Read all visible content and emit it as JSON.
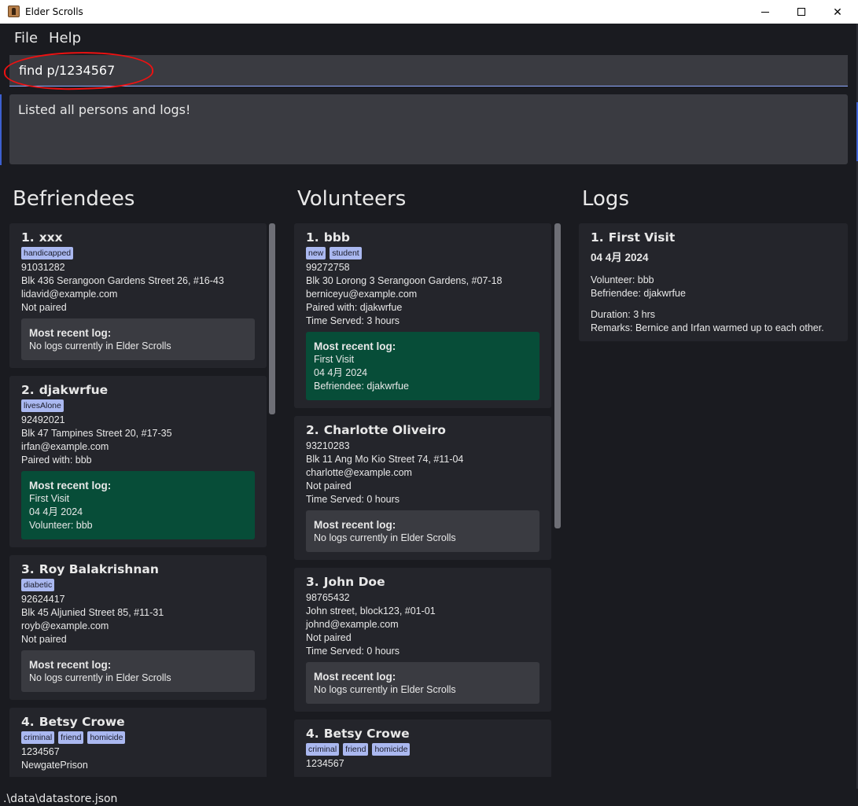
{
  "window": {
    "title": "Elder Scrolls"
  },
  "menu": {
    "file": "File",
    "help": "Help"
  },
  "command": {
    "value": "find p/1234567"
  },
  "result": {
    "text": "Listed all persons and logs!"
  },
  "headers": {
    "befriendees": "Befriendees",
    "volunteers": "Volunteers",
    "logs": "Logs"
  },
  "recent_label": "Most recent log:",
  "befriendees": [
    {
      "index": "1.",
      "name": "xxx",
      "tags": [
        "handicapped"
      ],
      "phone": "91031282",
      "address": "Blk 436 Serangoon Gardens Street 26, #16-43",
      "email": "lidavid@example.com",
      "pairing": "Not paired",
      "recent": {
        "empty": true,
        "lines": [
          "No logs currently in Elder Scrolls"
        ]
      }
    },
    {
      "index": "2.",
      "name": "djakwrfue",
      "tags": [
        "livesAlone"
      ],
      "phone": "92492021",
      "address": "Blk 47 Tampines Street 20, #17-35",
      "email": "irfan@example.com",
      "pairing": "Paired with: bbb",
      "recent": {
        "empty": false,
        "lines": [
          "First Visit",
          "04 4月 2024",
          "Volunteer: bbb"
        ]
      }
    },
    {
      "index": "3.",
      "name": "Roy Balakrishnan",
      "tags": [
        "diabetic"
      ],
      "phone": "92624417",
      "address": "Blk 45 Aljunied Street 85, #11-31",
      "email": "royb@example.com",
      "pairing": "Not paired",
      "recent": {
        "empty": true,
        "lines": [
          "No logs currently in Elder Scrolls"
        ]
      }
    },
    {
      "index": "4.",
      "name": "Betsy Crowe",
      "tags": [
        "criminal",
        "friend",
        "homicide"
      ],
      "phone": "1234567",
      "address": "NewgatePrison",
      "email": "",
      "pairing": "",
      "recent": null
    }
  ],
  "volunteers": [
    {
      "index": "1.",
      "name": "bbb",
      "tags": [
        "new",
        "student"
      ],
      "phone": "99272758",
      "address": "Blk 30 Lorong 3 Serangoon Gardens, #07-18",
      "email": "berniceyu@example.com",
      "pairing": "Paired with: djakwrfue",
      "time_served": "Time Served: 3 hours",
      "recent": {
        "empty": false,
        "lines": [
          "First Visit",
          "04 4月 2024",
          "Befriendee: djakwrfue"
        ]
      }
    },
    {
      "index": "2.",
      "name": "Charlotte Oliveiro",
      "tags": [],
      "phone": "93210283",
      "address": "Blk 11 Ang Mo Kio Street 74, #11-04",
      "email": "charlotte@example.com",
      "pairing": "Not paired",
      "time_served": "Time Served: 0 hours",
      "recent": {
        "empty": true,
        "lines": [
          "No logs currently in Elder Scrolls"
        ]
      }
    },
    {
      "index": "3.",
      "name": "John Doe",
      "tags": [],
      "phone": "98765432",
      "address": "John street, block123, #01-01",
      "email": "johnd@example.com",
      "pairing": "Not paired",
      "time_served": "Time Served: 0 hours",
      "recent": {
        "empty": true,
        "lines": [
          "No logs currently in Elder Scrolls"
        ]
      }
    },
    {
      "index": "4.",
      "name": "Betsy Crowe",
      "tags": [
        "criminal",
        "friend",
        "homicide"
      ],
      "phone": "1234567",
      "address": "",
      "email": "",
      "pairing": "",
      "time_served": "",
      "recent": null
    }
  ],
  "logs": [
    {
      "index": "1.",
      "title": "First Visit",
      "date": "04 4月 2024",
      "volunteer": "Volunteer: bbb",
      "befriendee": "Befriendee: djakwrfue",
      "duration": "Duration: 3 hrs",
      "remarks": "Remarks: Bernice and Irfan warmed up to each other."
    }
  ],
  "status": {
    "path": ".\\data\\datastore.json"
  },
  "colors": {
    "background": "#1a1b20",
    "card": "#24252b",
    "tag": "#aab8f0",
    "recent_filled": "#074d38",
    "recent_empty": "#3a3b41",
    "annotation": "#e11"
  }
}
